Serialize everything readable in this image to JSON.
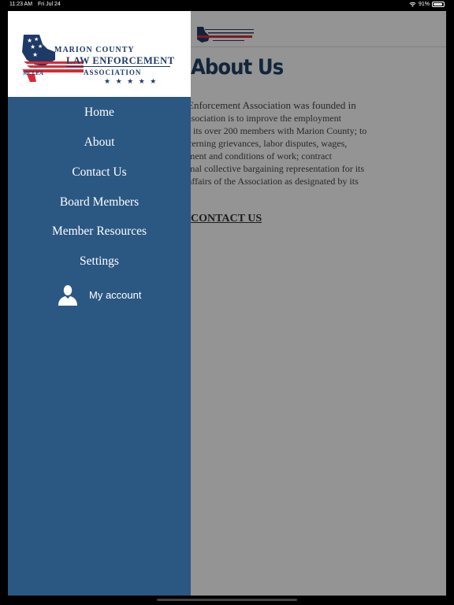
{
  "status_bar": {
    "time": "11:23 AM",
    "date": "Fri Jul 24",
    "battery": "91%"
  },
  "logo": {
    "line1": "MARION COUNTY",
    "line2": "LAW ENFORCEMENT",
    "line3": "ASSOCIATION",
    "abbr": "MCLEA",
    "stars": "★ ★ ★ ★ ★",
    "colors": {
      "navy": "#1e3a66",
      "red": "#d62b35"
    }
  },
  "menu": {
    "items": [
      {
        "label": "Home"
      },
      {
        "label": "About"
      },
      {
        "label": "Contact Us"
      },
      {
        "label": "Board Members"
      },
      {
        "label": "Member Resources"
      },
      {
        "label": "Settings"
      }
    ],
    "account_label": "My account"
  },
  "page": {
    "title": "About Us",
    "lines": [
      "Enforcement Association was founded in",
      "ssociation is to improve the employment",
      "f its over 200 members with Marion County; to",
      "cerning grievances, labor disputes, wages,",
      "ment and conditions of work; contract",
      "mal collective bargaining representation for its",
      "affairs of the Association as designated by its"
    ],
    "contact_link": "CONTACT US"
  },
  "colors": {
    "drawer": "#2b5783",
    "title": "#1f3e63"
  }
}
